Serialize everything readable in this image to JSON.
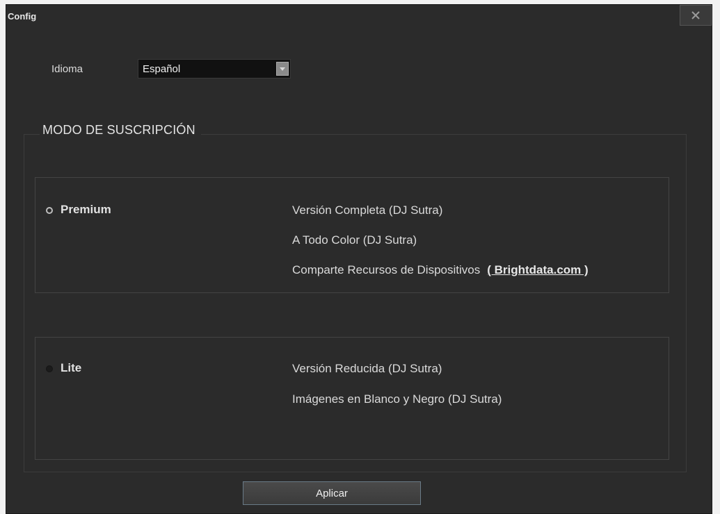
{
  "window": {
    "title": "Config",
    "close_icon": "close-icon"
  },
  "language": {
    "label": "Idioma",
    "selected": "Español",
    "dropdown_icon": "chevron-down-icon"
  },
  "subscription": {
    "group_title": "MODO DE SUSCRIPCIÓN",
    "options": [
      {
        "name": "Premium",
        "selected": true,
        "features": [
          "Versión Completa (DJ Sutra)",
          "A Todo Color (DJ Sutra)",
          "Comparte Recursos de Dispositivos"
        ],
        "link": "( Brightdata.com )"
      },
      {
        "name": "Lite",
        "selected": false,
        "features": [
          "Versión Reducida (DJ Sutra)",
          "Imágenes en Blanco y Negro (DJ Sutra)"
        ]
      }
    ]
  },
  "actions": {
    "apply_label": "Aplicar"
  },
  "colors": {
    "background": "#2b2b2b",
    "text": "#dadada",
    "button_border": "#6a7b88"
  }
}
